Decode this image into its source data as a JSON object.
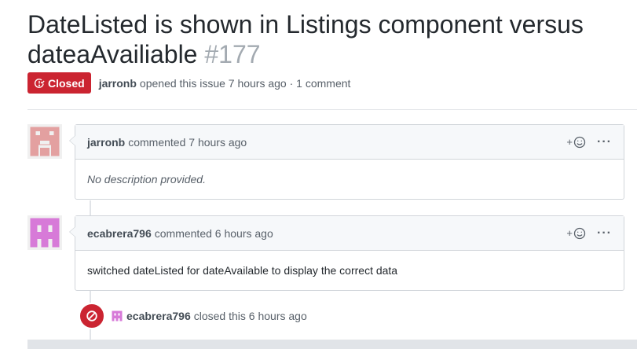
{
  "issue": {
    "title": "DateListed is shown in Listings component versus dateaAvailiable",
    "number": "#177",
    "state": "Closed",
    "author": "jarronb",
    "meta_text": "opened this issue 7 hours ago · 1 comment"
  },
  "comments": [
    {
      "author": "jarronb",
      "action": "commented 7 hours ago",
      "body": "No description provided.",
      "avatar_color": "#e3a0a0"
    },
    {
      "author": "ecabrera796",
      "action": "commented 6 hours ago",
      "body": "switched dateListed for dateAvailable to display the correct data",
      "avatar_color": "#d77ad8"
    }
  ],
  "reaction_label": "+",
  "more_label": "···",
  "event": {
    "author": "ecabrera796",
    "text": "closed this 6 hours ago",
    "icon": "circle-slash-icon"
  },
  "colors": {
    "closed_red": "#cb2431"
  }
}
